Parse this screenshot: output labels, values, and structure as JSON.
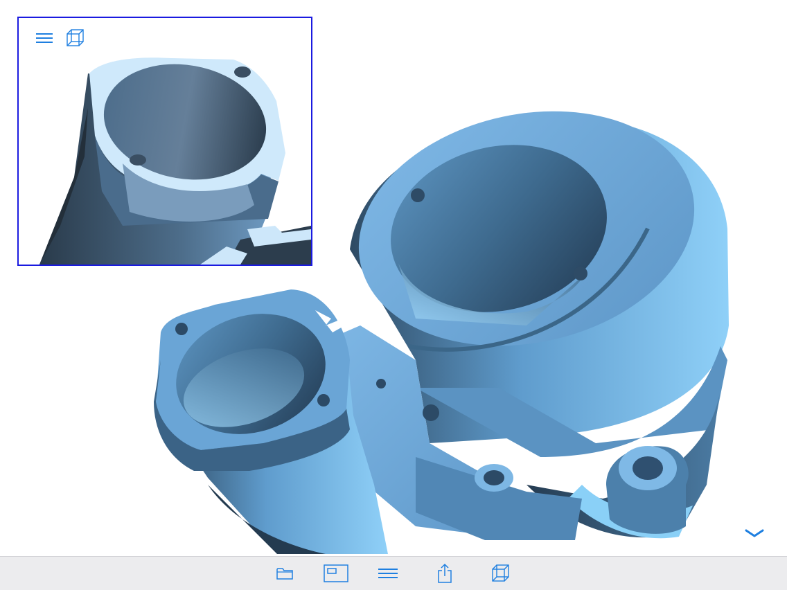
{
  "app": {
    "screen": "3d-model-viewer"
  },
  "viewport": {
    "model": "pump-housing-3d-part",
    "model_color": "#6aa6d8",
    "background": "#ffffff"
  },
  "inset_view": {
    "border_color": "#1a1ae0",
    "icons": [
      "menu-icon",
      "wireframe-cube-icon"
    ]
  },
  "toolbar": {
    "background": "#ececee",
    "icon_color": "#1e7fe0",
    "items": [
      {
        "icon": "folder-icon"
      },
      {
        "icon": "view-panel-icon"
      },
      {
        "icon": "menu-icon"
      },
      {
        "icon": "share-icon"
      },
      {
        "icon": "wireframe-cube-icon"
      }
    ]
  },
  "collapse_control": {
    "icon": "chevron-down-icon"
  }
}
